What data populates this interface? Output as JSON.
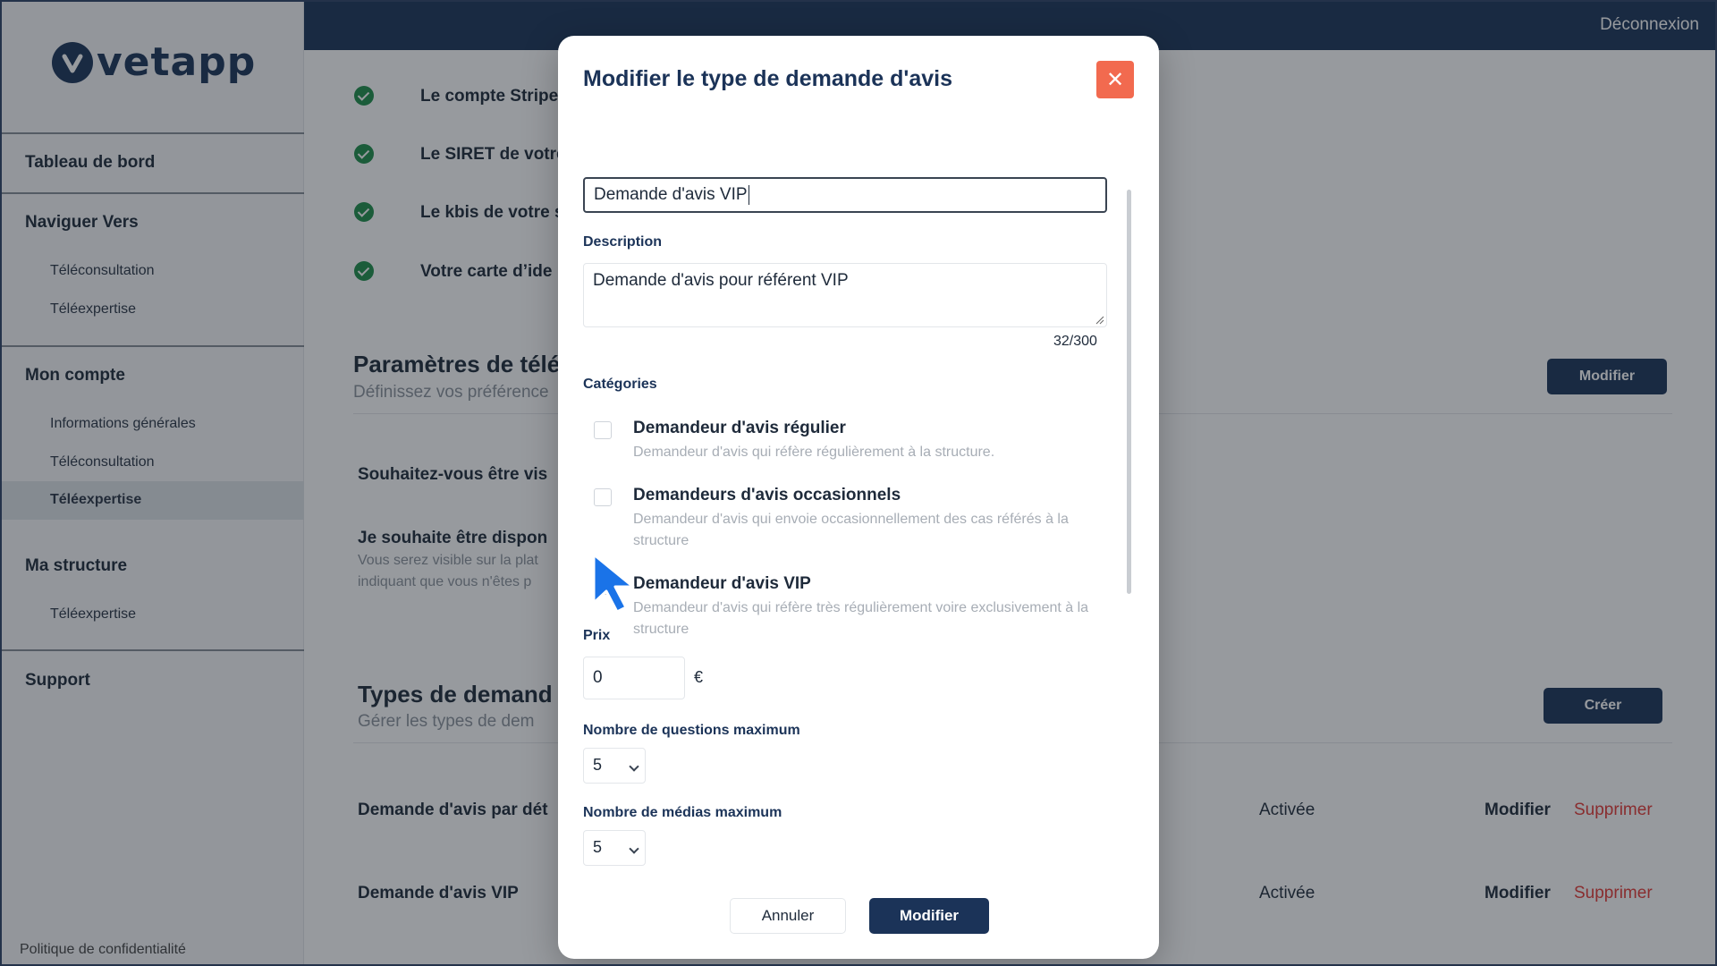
{
  "app": {
    "logo_text": "vetapp",
    "logout": "Déconnexion"
  },
  "sidebar": {
    "dashboard": "Tableau de bord",
    "navigate": {
      "title": "Naviguer Vers",
      "items": [
        "Téléconsultation",
        "Téléexpertise"
      ]
    },
    "account": {
      "title": "Mon compte",
      "items": [
        "Informations générales",
        "Téléconsultation",
        "Téléexpertise"
      ],
      "active": "Téléexpertise"
    },
    "structure": {
      "title": "Ma structure",
      "items": [
        "Téléexpertise"
      ]
    },
    "support": "Support",
    "footer": "Politique de confidentialité"
  },
  "main": {
    "checklist": [
      "Le compte Stripe",
      "Le SIRET de votre",
      "Le kbis de votre s",
      "Votre carte d’ide"
    ],
    "settings": {
      "title": "Paramètres de télé",
      "desc": "Définissez vos préférence",
      "button": "Modifier",
      "question": "Souhaitez-vous être vis",
      "availability_title": "Je souhaite être dispon",
      "availability_desc_1": "Vous serez visible sur la plat",
      "availability_desc_2": "indiquant que vous n'êtes p"
    },
    "types": {
      "title": "Types de demand",
      "desc": "Gérer les types de dem",
      "create_button": "Créer",
      "rows": [
        {
          "name": "Demande d'avis par dét",
          "status": "Activée",
          "edit": "Modifier",
          "delete": "Supprimer"
        },
        {
          "name": "Demande d'avis VIP",
          "status": "Activée",
          "edit": "Modifier",
          "delete": "Supprimer"
        }
      ]
    }
  },
  "modal": {
    "title": "Modifier le type de demande d'avis",
    "close": "✕",
    "name_value": "Demande d'avis VIP",
    "description_label": "Description",
    "description_value": "Demande d'avis pour référent VIP",
    "counter": "32/300",
    "categories_label": "Catégories",
    "categories": [
      {
        "title": "Demandeur d'avis régulier",
        "desc": "Demandeur d'avis qui réfère régulièrement à la structure.",
        "checked": false
      },
      {
        "title": "Demandeurs d'avis occasionnels",
        "desc": "Demandeur d'avis qui envoie occasionnellement des cas référés à la structure",
        "checked": false
      },
      {
        "title": "Demandeur d'avis VIP",
        "desc": "Demandeur d'avis qui réfère très régulièrement voire exclusivement à la structure",
        "checked": true
      }
    ],
    "price_label": "Prix",
    "price_value": "0",
    "currency": "€",
    "max_questions_label": "Nombre de questions maximum",
    "max_questions_value": "5",
    "max_media_label": "Nombre de médias maximum",
    "max_media_value": "5",
    "cancel": "Annuler",
    "submit": "Modifier"
  },
  "colors": {
    "navy": "#1b3358",
    "danger": "#e53935",
    "close": "#f26a4f",
    "success": "#1e8e4a"
  }
}
